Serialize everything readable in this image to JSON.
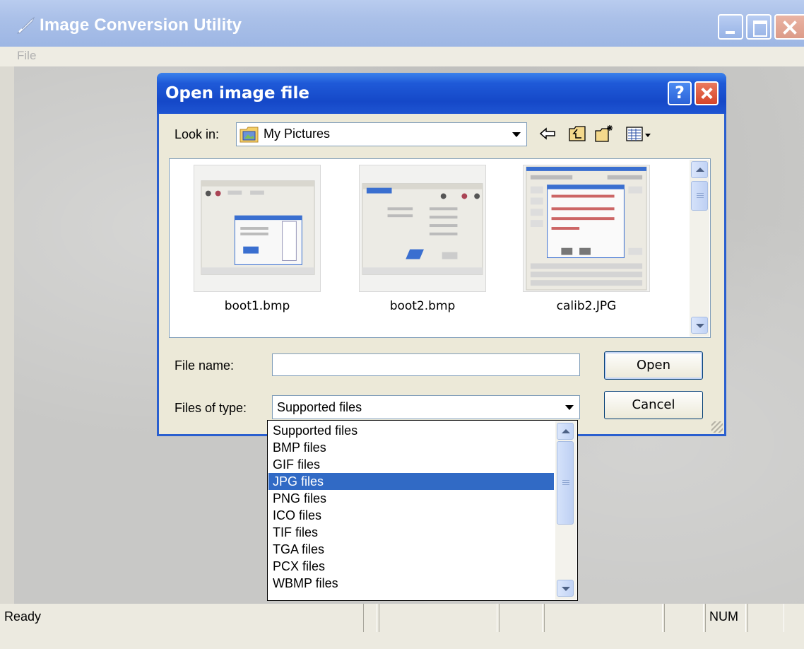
{
  "window": {
    "title": "Image Conversion Utility",
    "menu": [
      "File"
    ]
  },
  "status": {
    "text": "Ready",
    "num": "NUM"
  },
  "dialog": {
    "title": "Open image file",
    "help_symbol": "?",
    "look_in_label": "Look in:",
    "look_in_value": "My Pictures",
    "files": [
      {
        "name": "boot1.bmp"
      },
      {
        "name": "boot2.bmp"
      },
      {
        "name": "calib2.JPG"
      }
    ],
    "file_name_label": "File name:",
    "file_name_value": "",
    "files_of_type_label": "Files of type:",
    "files_of_type_value": "Supported files",
    "open_label": "Open",
    "cancel_label": "Cancel",
    "type_options": [
      "Supported files",
      "BMP files",
      "GIF files",
      "JPG files",
      "PNG files",
      "ICO files",
      "TIF files",
      "TGA files",
      "PCX files",
      "WBMP files"
    ],
    "selected_option": "JPG files"
  },
  "colors": {
    "dialog_title_bar": "#1548c8",
    "selection": "#316ac5",
    "window_title_bar": "#aac0e8"
  },
  "icons": {
    "app": "feather-pen-icon",
    "folder": "my-pictures-folder-icon",
    "back": "back-arrow-icon",
    "up": "up-one-level-icon",
    "new_folder": "new-folder-icon",
    "view": "view-menu-icon"
  }
}
